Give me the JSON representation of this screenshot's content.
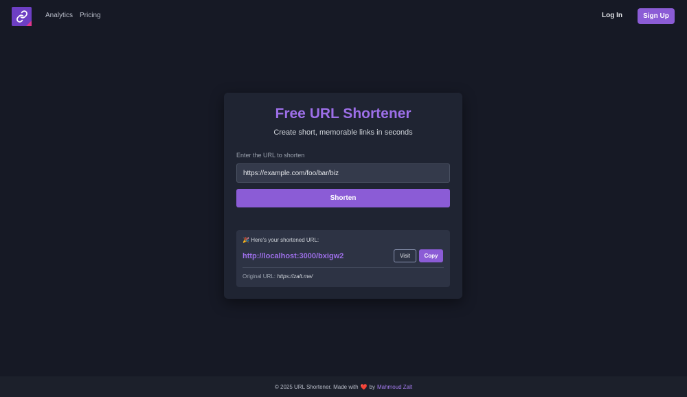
{
  "header": {
    "logo_icon": "link-icon",
    "nav": [
      {
        "label": "Analytics"
      },
      {
        "label": "Pricing"
      }
    ],
    "login_label": "Log In",
    "signup_label": "Sign Up"
  },
  "card": {
    "title": "Free URL Shortener",
    "subtitle": "Create short, memorable links in seconds",
    "input_label": "Enter the URL to shorten",
    "input_value": "https://example.com/foo/bar/biz",
    "shorten_label": "Shorten"
  },
  "result": {
    "heading_icon": "🎉",
    "heading": "Here's your shortened URL:",
    "short_url": "http://localhost:3000/bxigw2",
    "visit_label": "Visit",
    "copy_label": "Copy",
    "original_prefix": "Original URL:",
    "original_url": "https://zalt.me/"
  },
  "footer": {
    "text_before": "© 2025 URL Shortener. Made with",
    "heart": "❤️",
    "by": "by",
    "author": "Mahmoud Zalt"
  },
  "colors": {
    "background": "#161925",
    "card": "#1f2432",
    "accent": "#8b5cd6",
    "accent_text": "#9d6fe8"
  }
}
